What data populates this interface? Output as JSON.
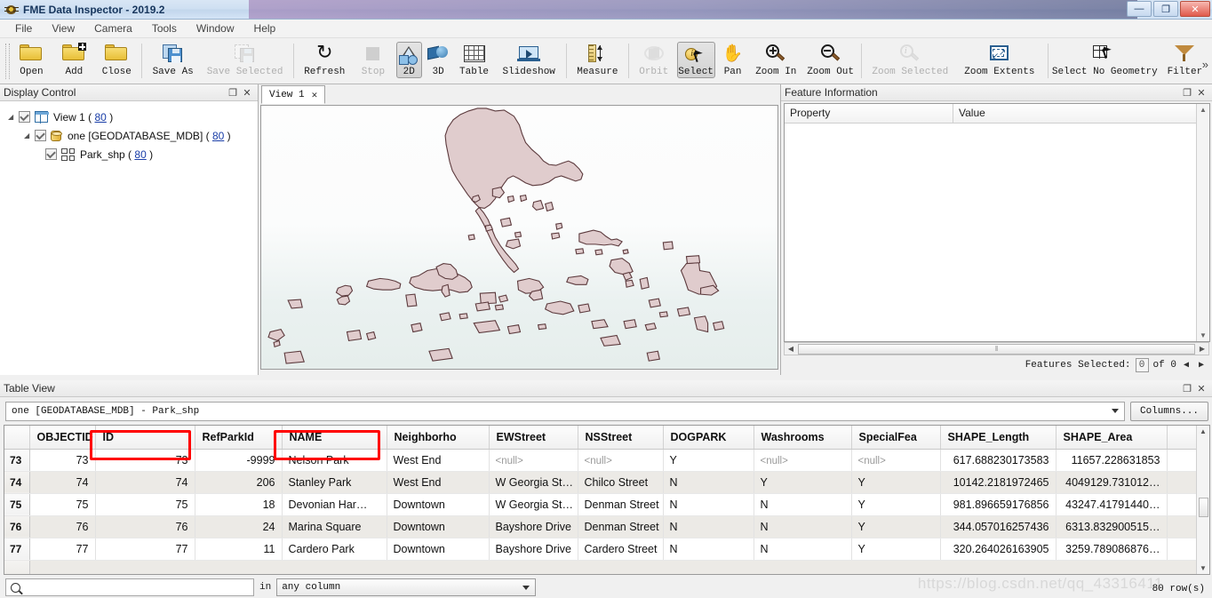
{
  "window": {
    "title": "FME Data Inspector - 2019.2",
    "icon": "fme-app-icon",
    "minimize": "—",
    "maximize": "❐",
    "close": "✕"
  },
  "menubar": {
    "items": [
      "File",
      "View",
      "Camera",
      "Tools",
      "Window",
      "Help"
    ]
  },
  "toolbar": {
    "overflow": "»",
    "items": [
      {
        "label": "Open",
        "icon": "folder-open-icon",
        "state": "normal",
        "width": "normal"
      },
      {
        "label": "Add",
        "icon": "folder-add-icon",
        "state": "normal",
        "width": "normal"
      },
      {
        "label": "Close",
        "icon": "folder-close-icon",
        "state": "normal",
        "width": "normal"
      },
      {
        "label": "Save As",
        "icon": "save-as-icon",
        "state": "normal",
        "width": "wide"
      },
      {
        "label": "Save Selected",
        "icon": "save-selected-icon",
        "state": "disabled",
        "width": "xxwide"
      },
      {
        "label": "Refresh",
        "icon": "refresh-icon",
        "state": "normal",
        "width": "wide"
      },
      {
        "label": "Stop",
        "icon": "stop-icon",
        "state": "disabled",
        "width": "normal"
      },
      {
        "label": "2D",
        "icon": "view-2d-icon",
        "state": "checked",
        "width": "small"
      },
      {
        "label": "3D",
        "icon": "view-3d-icon",
        "state": "normal",
        "width": "small"
      },
      {
        "label": "Table",
        "icon": "table-icon",
        "state": "normal",
        "width": "normal"
      },
      {
        "label": "Slideshow",
        "icon": "slideshow-icon",
        "state": "normal",
        "width": "xwide"
      },
      {
        "label": "Measure",
        "icon": "measure-icon",
        "state": "normal",
        "width": "wide"
      },
      {
        "label": "Orbit",
        "icon": "orbit-icon",
        "state": "disabled",
        "width": "normal"
      },
      {
        "label": "Select",
        "icon": "select-icon",
        "state": "checked",
        "width": "normal"
      },
      {
        "label": "Pan",
        "icon": "pan-hand-icon",
        "state": "normal",
        "width": "normal"
      },
      {
        "label": "Zoom In",
        "icon": "zoom-in-icon",
        "state": "normal",
        "width": "wide"
      },
      {
        "label": "Zoom Out",
        "icon": "zoom-out-icon",
        "state": "normal",
        "width": "wide"
      },
      {
        "label": "Zoom Selected",
        "icon": "zoom-selected-icon",
        "state": "disabled",
        "width": "xxwide"
      },
      {
        "label": "Zoom Extents",
        "icon": "zoom-extents-icon",
        "state": "normal",
        "width": "xxwide"
      },
      {
        "label": "Select No Geometry",
        "icon": "select-no-geometry-icon",
        "state": "normal",
        "width": "nogeo"
      },
      {
        "label": "Filter",
        "icon": "filter-icon",
        "state": "normal",
        "width": "wide"
      }
    ]
  },
  "display_control": {
    "title": "Display Control",
    "float_glyph": "❐",
    "close_glyph": "✕",
    "tree": [
      {
        "label": "View 1",
        "count": "80",
        "icon": "view-window-icon",
        "level": 1,
        "twisty": "◢",
        "checked": true
      },
      {
        "label": "one [GEODATABASE_MDB]",
        "count": "80",
        "icon": "database-icon",
        "level": 2,
        "twisty": "◢",
        "checked": true
      },
      {
        "label": "Park_shp",
        "count": "80",
        "icon": "layer-table-icon",
        "level": 3,
        "twisty": "",
        "checked": true
      }
    ],
    "paren_open": "(",
    "paren_close": ")"
  },
  "view_tab": {
    "label": "View 1",
    "close_glyph": "✕"
  },
  "feature_info": {
    "title": "Feature Information",
    "float_glyph": "❐",
    "close_glyph": "✕",
    "columns": [
      "Property",
      "Value"
    ],
    "rows": [],
    "status": {
      "label": "Features Selected:",
      "selected": "0",
      "of": "of 0",
      "prev_glyph": "◀",
      "next_glyph": "▶"
    },
    "hscroll_thumb": "‖"
  },
  "table_view": {
    "title": "Table View",
    "float_glyph": "❐",
    "close_glyph": "✕",
    "dataset_selector": "one [GEODATABASE_MDB] - Park_shp",
    "columns_button": "Columns...",
    "columns": [
      "OBJECTID",
      "ID",
      "RefParkId",
      "NAME",
      "Neighborho",
      "EWStreet",
      "NSStreet",
      "DOGPARK",
      "Washrooms",
      "SpecialFea",
      "SHAPE_Length",
      "SHAPE_Area"
    ],
    "highlighted_columns": [
      "ID",
      "NAME"
    ],
    "rows": [
      {
        "rownum": "73",
        "cells": [
          "73",
          "73",
          "-9999",
          "Nelson Park",
          "West End",
          "<null>",
          "<null>",
          "Y",
          "<null>",
          "<null>",
          "617.688230173583",
          "11657.228631853"
        ]
      },
      {
        "rownum": "74",
        "cells": [
          "74",
          "74",
          "206",
          "Stanley Park",
          "West End",
          "W Georgia St…",
          "Chilco Street",
          "N",
          "Y",
          "Y",
          "10142.2181972465",
          "4049129.731012…"
        ]
      },
      {
        "rownum": "75",
        "cells": [
          "75",
          "75",
          "18",
          "Devonian Har…",
          "Downtown",
          "W Georgia St…",
          "Denman Street",
          "N",
          "N",
          "Y",
          "981.896659176856",
          "43247.41791440…"
        ]
      },
      {
        "rownum": "76",
        "cells": [
          "76",
          "76",
          "24",
          "Marina Square",
          "Downtown",
          "Bayshore Drive",
          "Denman Street",
          "N",
          "N",
          "Y",
          "344.057016257436",
          "6313.832900515…"
        ]
      },
      {
        "rownum": "77",
        "cells": [
          "77",
          "77",
          "11",
          "Cardero Park",
          "Downtown",
          "Bayshore Drive",
          "Cardero Street",
          "N",
          "N",
          "Y",
          "320.264026163905",
          "3259.789086876…"
        ]
      }
    ],
    "search": {
      "value": "",
      "icon": "search-icon",
      "in_label": "in",
      "scope": "any column"
    },
    "row_count": "80 row(s)"
  },
  "watermark": "https://blog.csdn.net/qq_43316411",
  "colors": {
    "annotation": "#ff0000",
    "map_fill": "#e0ccce",
    "map_stroke": "#5c3a3d",
    "link": "#1a3ea8"
  }
}
